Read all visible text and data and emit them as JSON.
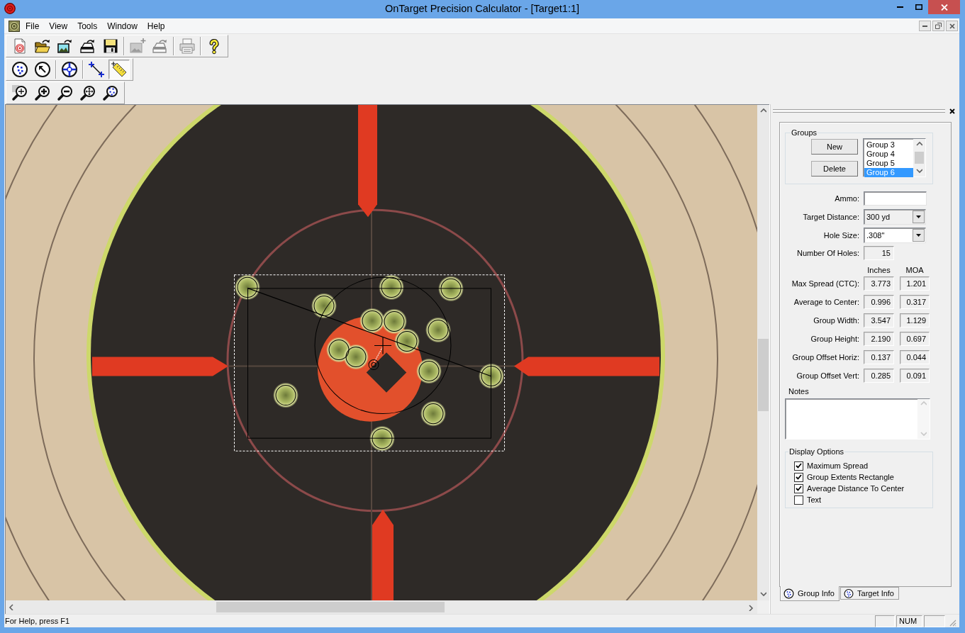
{
  "window": {
    "title": "OnTarget Precision Calculator - [Target1:1]"
  },
  "menu": [
    "File",
    "View",
    "Tools",
    "Window",
    "Help"
  ],
  "toolbars": [
    {
      "groups": [
        [
          {
            "disabled": false
          },
          {
            "disabled": false
          },
          {
            "disabled": false
          },
          {
            "disabled": false
          },
          {
            "disabled": false
          }
        ],
        [
          {
            "disabled": true
          },
          {
            "disabled": true
          }
        ],
        [
          {
            "disabled": true
          }
        ],
        [
          {
            "disabled": false
          }
        ]
      ]
    },
    {
      "groups": [
        [
          {
            "selected": false
          },
          {
            "selected": false
          }
        ],
        [
          {
            "selected": false
          }
        ],
        [
          {
            "selected": false
          },
          {
            "selected": true
          }
        ]
      ]
    },
    {
      "groups": [
        [
          {
            "disabled": false
          },
          {
            "disabled": false
          },
          {
            "disabled": false
          },
          {
            "disabled": false
          },
          {
            "disabled": false
          }
        ]
      ]
    }
  ],
  "side_panel": {
    "groups": {
      "title": "Groups",
      "buttons": [
        "New",
        "Delete"
      ],
      "list": [
        {
          "label": "Group 3",
          "selected": false
        },
        {
          "label": "Group 4",
          "selected": false
        },
        {
          "label": "Group 5",
          "selected": false
        },
        {
          "label": "Group 6",
          "selected": true
        }
      ]
    },
    "fields": [
      {
        "label": "Ammo:",
        "kind": "text"
      },
      {
        "label": "Target Distance:",
        "kind": "dropdown",
        "value": "300 yd"
      },
      {
        "label": "Hole Size:",
        "kind": "combo",
        "value": ".308\""
      },
      {
        "label": "Number Of Holes:",
        "kind": "readonly",
        "value": "15"
      }
    ],
    "measurements": {
      "columns": [
        "Inches",
        "MOA"
      ],
      "rows": [
        {
          "label": "Max Spread (CTC):",
          "inches": "3.773",
          "moa": "1.201"
        },
        {
          "label": "Average to Center:",
          "inches": "0.996",
          "moa": "0.317"
        },
        {
          "label": "Group Width:",
          "inches": "3.547",
          "moa": "1.129"
        },
        {
          "label": "Group Height:",
          "inches": "2.190",
          "moa": "0.697"
        },
        {
          "label": "Group Offset Horiz:",
          "inches": "0.137",
          "moa": "0.044"
        },
        {
          "label": "Group Offset Vert:",
          "inches": "0.285",
          "moa": "0.091"
        }
      ]
    },
    "notes": {
      "label": "Notes"
    },
    "display_options": {
      "title": "Display Options",
      "items": [
        {
          "label": "Maximum Spread",
          "checked": true
        },
        {
          "label": "Group Extents Rectangle",
          "checked": true
        },
        {
          "label": "Average Distance To Center",
          "checked": true
        },
        {
          "label": "Text",
          "checked": false
        }
      ]
    },
    "tabs": [
      {
        "label": "Group Info",
        "selected": true
      },
      {
        "label": "Target Info",
        "selected": false
      }
    ]
  },
  "status_bar": {
    "text": "For Help, press F1",
    "indicator": "NUM"
  }
}
